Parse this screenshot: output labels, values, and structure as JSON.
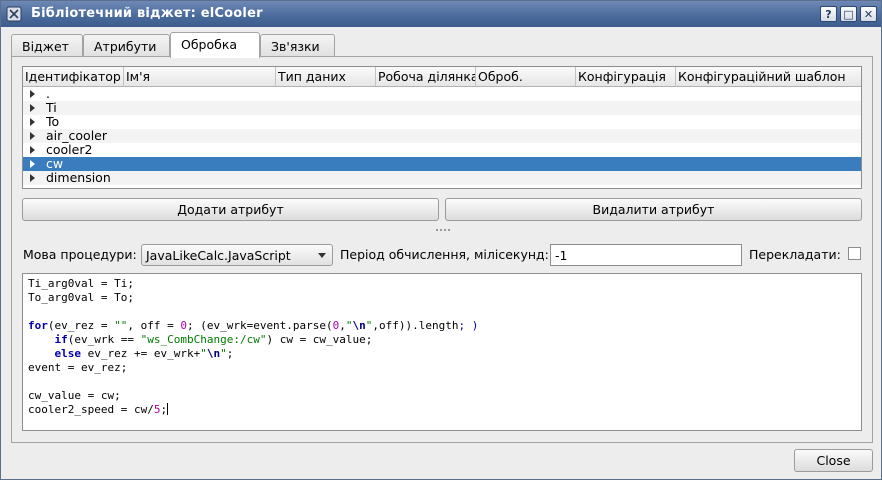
{
  "window": {
    "title": "Бібліотечний віджет: elCooler",
    "help_glyph": "?",
    "maximize_glyph": "□",
    "close_glyph": "✕"
  },
  "tabs": [
    {
      "label": "Віджет"
    },
    {
      "label": "Атрибути"
    },
    {
      "label": "Обробка",
      "active": true
    },
    {
      "label": "Зв'язки"
    }
  ],
  "attr_table": {
    "columns": [
      "Ідентифікатор",
      "Ім'я",
      "Тип даних",
      "Робоча ділянка",
      "Оброб.",
      "Конфігурація",
      "Конфігураційний шаблон"
    ],
    "rows": [
      {
        "id": "."
      },
      {
        "id": "Ti"
      },
      {
        "id": "To"
      },
      {
        "id": "air_cooler"
      },
      {
        "id": "cooler2"
      },
      {
        "id": "cw",
        "selected": true
      },
      {
        "id": "dimension"
      }
    ],
    "selection_color": "#3a7dbf"
  },
  "buttons": {
    "add_attr": "Додати атрибут",
    "del_attr": "Видалити атрибут",
    "close": "Close"
  },
  "proc": {
    "lang_label": "Мова процедури:",
    "lang_value": "JavaLikeCalc.JavaScript",
    "period_label": "Період обчислення, мілісекунд:",
    "period_value": "-1",
    "translate_label": "Перекладати:",
    "translate_checked": false
  },
  "code_lines": [
    "Ti_arg0val = Ti;",
    "To_arg0val = To;",
    "",
    "for(ev_rez = \"\", off = 0; (ev_wrk=event.parse(0,\"\\n\",off)).length; )",
    "    if(ev_wrk == \"ws_CombChange:/cw\") cw = cw_value;",
    "    else ev_rez += ev_wrk+\"\\n\";",
    "event = ev_rez;",
    "",
    "cw_value = cw;",
    "cooler2_speed = cw/5;"
  ]
}
